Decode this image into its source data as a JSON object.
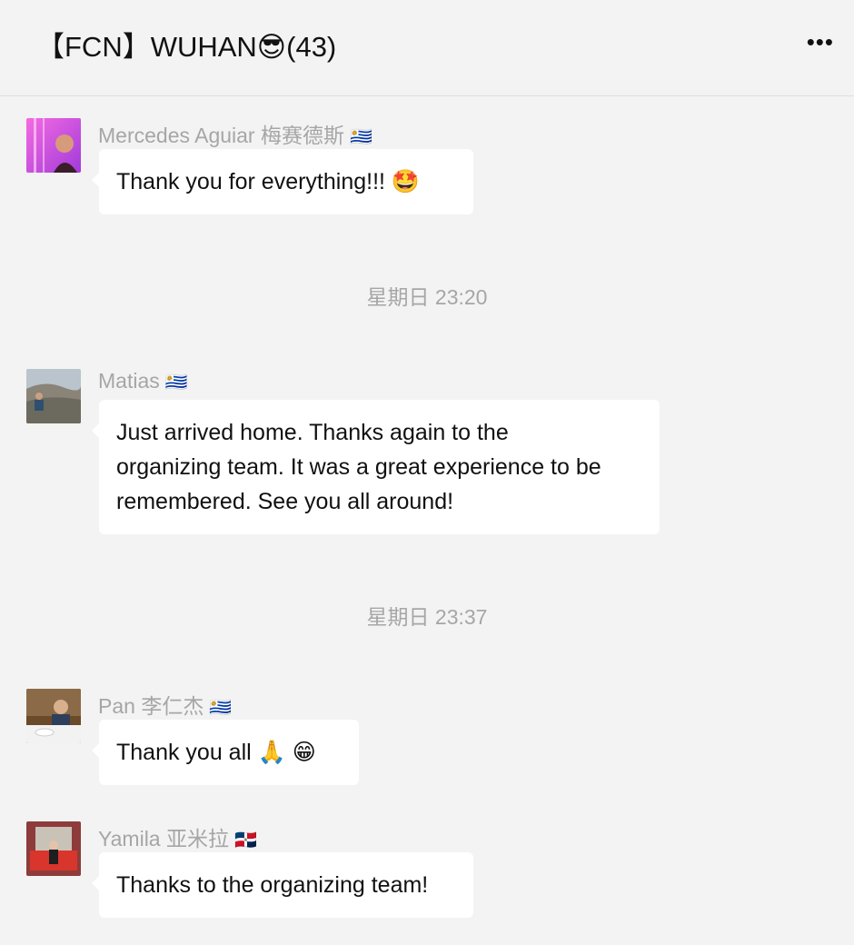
{
  "header": {
    "title": "【FCN】WUHAN😎(43)",
    "more_label": "•••"
  },
  "messages": [
    {
      "sender": "Mercedes Aguiar 梅赛德斯",
      "flag": "🇺🇾",
      "text": "Thank you for everything!!!  🤩"
    },
    {
      "time": "星期日 23:20"
    },
    {
      "sender": "Matias",
      "flag": "🇺🇾",
      "text_lines": [
        "Just arrived home. Thanks again to the",
        "organizing team. It was a great experience to be",
        "remembered. See you all around!"
      ]
    },
    {
      "time": "星期日 23:37"
    },
    {
      "sender": "Pan 李仁杰",
      "flag": "🇺🇾",
      "text": "Thank you all 🙏 😁"
    },
    {
      "sender": "Yamila 亚米拉",
      "flag": "🇩🇴",
      "text": "Thanks to the organizing team!"
    }
  ],
  "colors": {
    "background": "#f3f3f3",
    "bubble": "#ffffff",
    "meta_text": "#a6a6a6"
  }
}
